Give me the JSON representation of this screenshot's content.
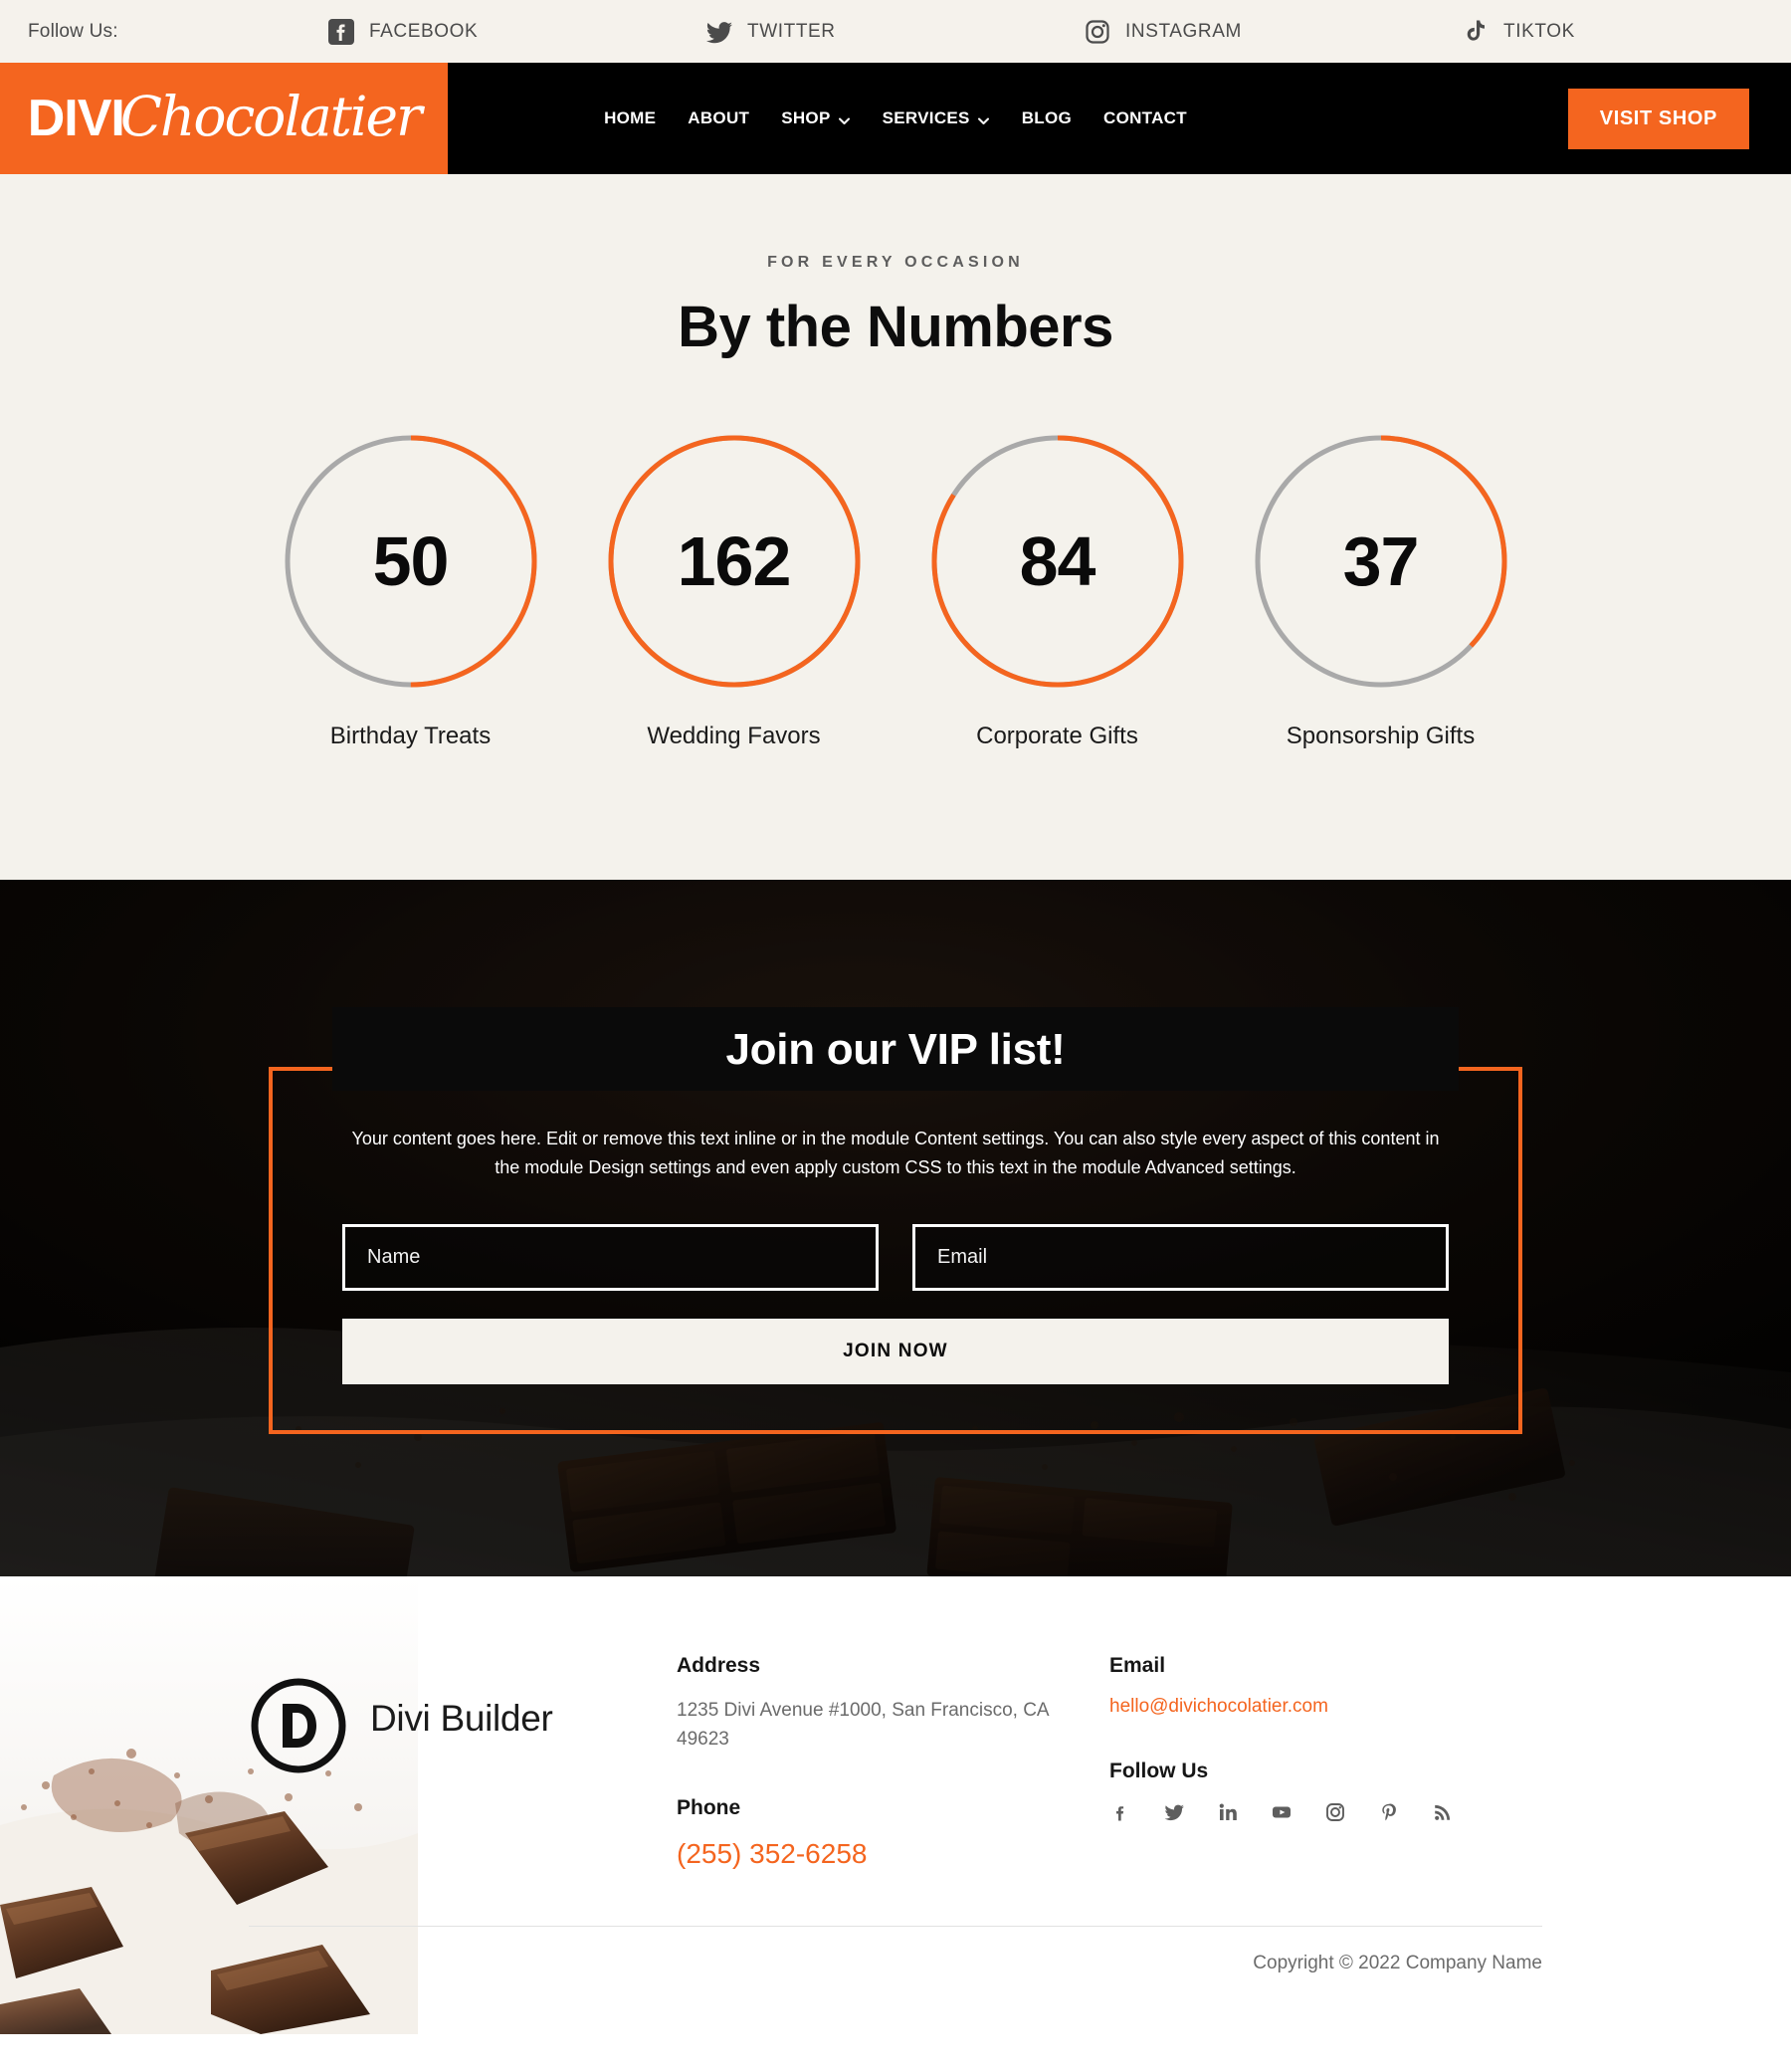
{
  "topbar": {
    "follow_label": "Follow Us:",
    "socials": [
      {
        "name": "facebook",
        "label": "FACEBOOK"
      },
      {
        "name": "twitter",
        "label": "TWITTER"
      },
      {
        "name": "instagram",
        "label": "INSTAGRAM"
      },
      {
        "name": "tiktok",
        "label": "TIKTOK"
      }
    ]
  },
  "header": {
    "logo_primary": "DIVI",
    "logo_script": "Chocolatier",
    "nav": [
      {
        "label": "HOME",
        "has_dropdown": false
      },
      {
        "label": "ABOUT",
        "has_dropdown": false
      },
      {
        "label": "SHOP",
        "has_dropdown": true
      },
      {
        "label": "SERVICES",
        "has_dropdown": true
      },
      {
        "label": "BLOG",
        "has_dropdown": false
      },
      {
        "label": "CONTACT",
        "has_dropdown": false
      }
    ],
    "cta_label": "VISIT SHOP"
  },
  "numbers": {
    "eyebrow": "FOR EVERY OCCASION",
    "title": "By the Numbers"
  },
  "chart_data": {
    "type": "bar",
    "title": "By the Numbers",
    "subtitle": "FOR EVERY OCCASION",
    "categories": [
      "Birthday Treats",
      "Wedding Favors",
      "Corporate Gifts",
      "Sponsorship Gifts"
    ],
    "values": [
      50,
      162,
      84,
      37
    ],
    "percent_filled": [
      50,
      100,
      84,
      37
    ],
    "display_as": "circle-counters",
    "accent_color": "#f4651f",
    "track_color": "#a9a9a9",
    "xlabel": "",
    "ylabel": "",
    "ylim": [
      0,
      100
    ],
    "grid": false,
    "legend": false
  },
  "vip": {
    "title": "Join our VIP list!",
    "copy": "Your content goes here. Edit or remove this text inline or in the module Content settings. You can also style every aspect of this content in the module Design settings and even apply custom CSS to this text in the module Advanced settings.",
    "name_placeholder": "Name",
    "name_value": "",
    "email_placeholder": "Email",
    "email_value": "",
    "submit_label": "JOIN NOW"
  },
  "footer": {
    "brand": "Divi Builder",
    "address_heading": "Address",
    "address_text": "1235 Divi Avenue #1000, San Francisco, CA 49623",
    "phone_heading": "Phone",
    "phone_value": "(255) 352-6258",
    "email_heading": "Email",
    "email_value": "hello@divichocolatier.com",
    "follow_heading": "Follow Us",
    "socials": [
      "facebook",
      "twitter",
      "linkedin",
      "youtube",
      "instagram",
      "pinterest",
      "rss"
    ],
    "copyright": "Copyright © 2022 Company Name"
  },
  "colors": {
    "accent": "#f4651f",
    "cream": "#f4f2ec",
    "dark": "#000000",
    "muted": "#6b6b6b",
    "track": "#a9a9a9"
  }
}
